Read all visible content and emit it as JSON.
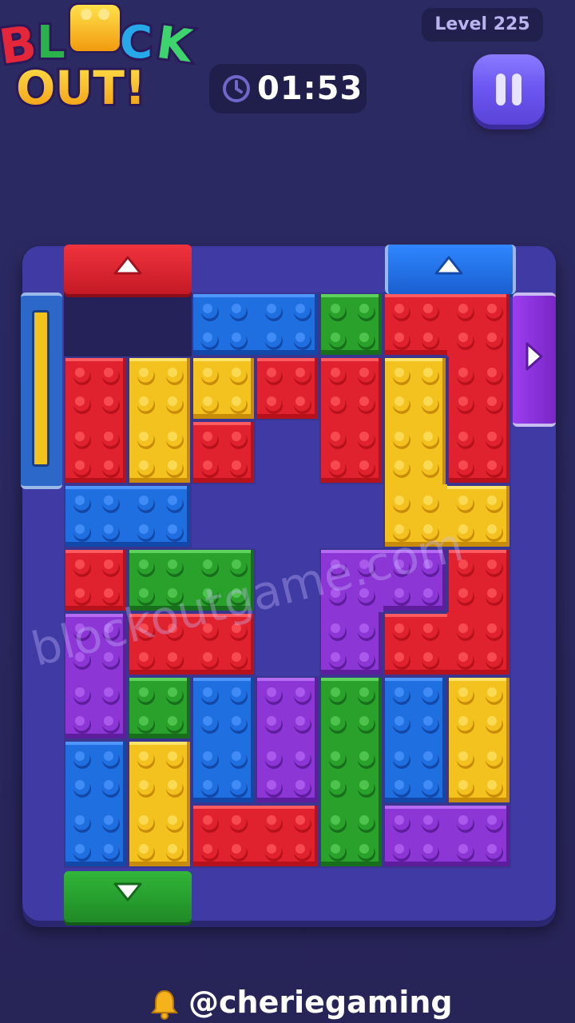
{
  "app": {
    "logo_line1": "BLOCK",
    "logo_line2": "OUT!"
  },
  "header": {
    "level_label": "Level 225",
    "timer": "01:53"
  },
  "colors": {
    "red": "#e0222e",
    "blue": "#1f6fe0",
    "green": "#2aa12a",
    "yellow": "#f4c21e",
    "purple": "#8d36d6"
  },
  "blocks": [
    {
      "color": "blue",
      "cells": [
        [
          0,
          2
        ],
        [
          0,
          3
        ]
      ]
    },
    {
      "color": "green",
      "cells": [
        [
          0,
          4
        ]
      ]
    },
    {
      "color": "red",
      "cells": [
        [
          0,
          5
        ],
        [
          0,
          6
        ],
        [
          1,
          6
        ],
        [
          2,
          6
        ]
      ]
    },
    {
      "color": "red",
      "cells": [
        [
          1,
          0
        ],
        [
          2,
          0
        ]
      ]
    },
    {
      "color": "yellow",
      "cells": [
        [
          1,
          1
        ],
        [
          2,
          1
        ]
      ]
    },
    {
      "color": "yellow",
      "cells": [
        [
          1,
          2
        ]
      ]
    },
    {
      "color": "red",
      "cells": [
        [
          1,
          3
        ]
      ]
    },
    {
      "color": "red",
      "cells": [
        [
          2,
          2
        ]
      ]
    },
    {
      "color": "red",
      "cells": [
        [
          1,
          4
        ],
        [
          2,
          4
        ]
      ]
    },
    {
      "color": "yellow",
      "cells": [
        [
          1,
          5
        ],
        [
          2,
          5
        ],
        [
          3,
          5
        ],
        [
          3,
          6
        ]
      ]
    },
    {
      "color": "blue",
      "cells": [
        [
          3,
          0
        ],
        [
          3,
          1
        ]
      ]
    },
    {
      "color": "red",
      "cells": [
        [
          4,
          0
        ]
      ]
    },
    {
      "color": "green",
      "cells": [
        [
          4,
          1
        ],
        [
          4,
          2
        ]
      ]
    },
    {
      "color": "purple",
      "cells": [
        [
          4,
          4
        ],
        [
          4,
          5
        ],
        [
          5,
          4
        ]
      ]
    },
    {
      "color": "red",
      "cells": [
        [
          4,
          6
        ],
        [
          5,
          5
        ],
        [
          5,
          6
        ]
      ]
    },
    {
      "color": "purple",
      "cells": [
        [
          5,
          0
        ],
        [
          6,
          0
        ]
      ]
    },
    {
      "color": "red",
      "cells": [
        [
          5,
          1
        ],
        [
          5,
          2
        ]
      ]
    },
    {
      "color": "green",
      "cells": [
        [
          6,
          1
        ]
      ]
    },
    {
      "color": "blue",
      "cells": [
        [
          6,
          2
        ],
        [
          7,
          2
        ]
      ]
    },
    {
      "color": "purple",
      "cells": [
        [
          6,
          3
        ],
        [
          7,
          3
        ]
      ]
    },
    {
      "color": "green",
      "cells": [
        [
          6,
          4
        ],
        [
          7,
          4
        ],
        [
          8,
          4
        ]
      ]
    },
    {
      "color": "blue",
      "cells": [
        [
          6,
          5
        ],
        [
          7,
          5
        ]
      ]
    },
    {
      "color": "yellow",
      "cells": [
        [
          6,
          6
        ],
        [
          7,
          6
        ]
      ]
    },
    {
      "color": "blue",
      "cells": [
        [
          7,
          0
        ],
        [
          8,
          0
        ]
      ]
    },
    {
      "color": "yellow",
      "cells": [
        [
          7,
          1
        ],
        [
          8,
          1
        ]
      ]
    },
    {
      "color": "red",
      "cells": [
        [
          8,
          2
        ],
        [
          8,
          3
        ]
      ]
    },
    {
      "color": "purple",
      "cells": [
        [
          8,
          5
        ],
        [
          8,
          6
        ]
      ]
    }
  ],
  "gates": [
    {
      "color": "red",
      "side": "top",
      "arrow": "up"
    },
    {
      "color": "blue",
      "side": "top",
      "arrow": "up"
    },
    {
      "color": "purple",
      "side": "right",
      "arrow": "right"
    },
    {
      "color": "yellow",
      "side": "left",
      "arrow": "none"
    },
    {
      "color": "green",
      "side": "bottom",
      "arrow": "down"
    }
  ],
  "watermark": "blockoutgame.com",
  "footer": {
    "handle": "@cheriegaming"
  }
}
